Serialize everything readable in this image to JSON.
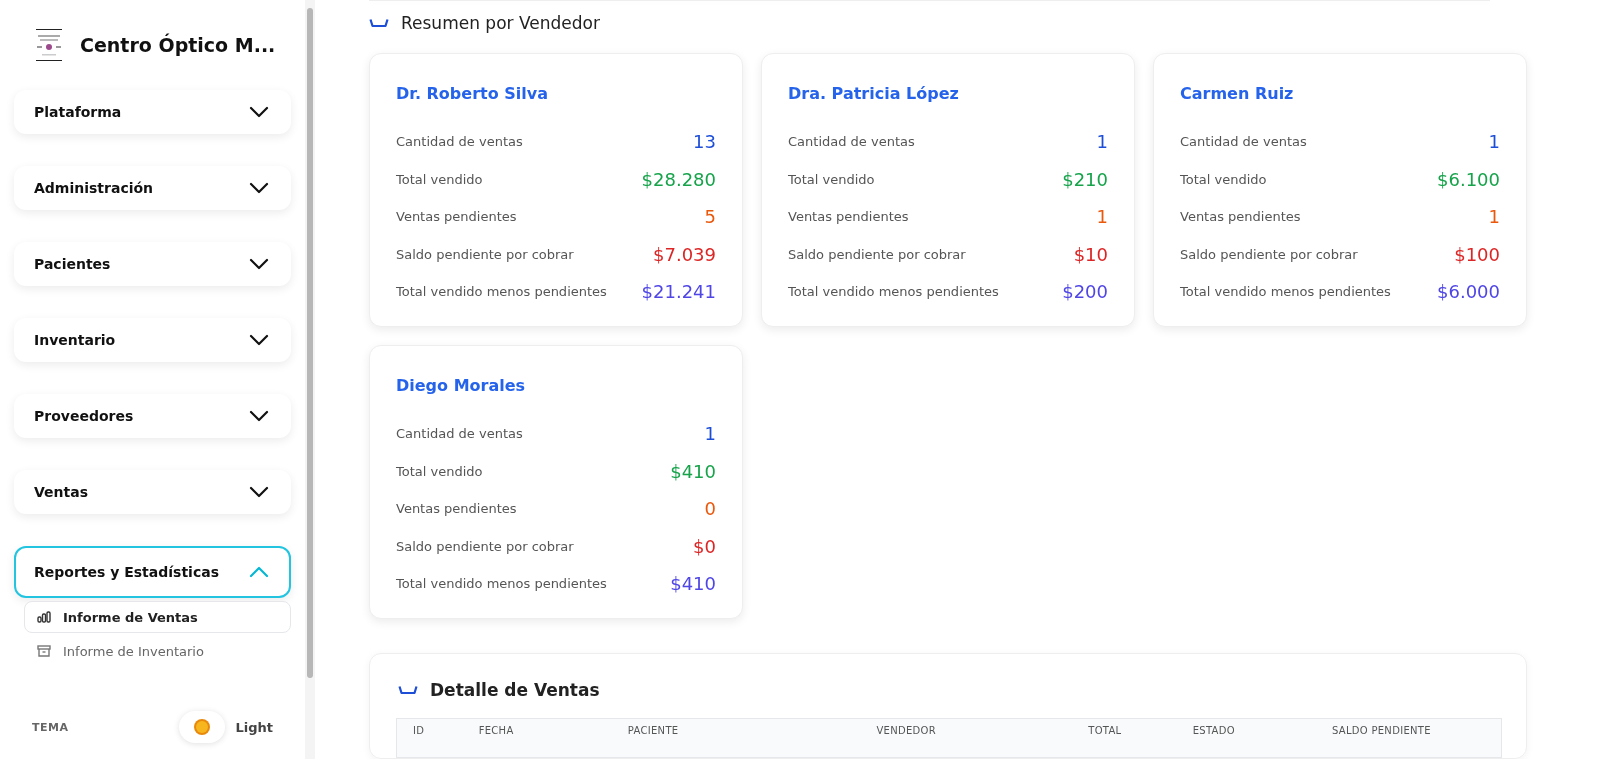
{
  "brand": {
    "name": "Centro Óptico M..."
  },
  "nav": [
    {
      "label": "Plataforma",
      "expanded": false
    },
    {
      "label": "Administración",
      "expanded": false
    },
    {
      "label": "Pacientes",
      "expanded": false
    },
    {
      "label": "Inventario",
      "expanded": false
    },
    {
      "label": "Proveedores",
      "expanded": false
    },
    {
      "label": "Ventas",
      "expanded": false
    },
    {
      "label": "Reportes y Estadísticas",
      "expanded": true,
      "children": [
        {
          "label": "Informe de Ventas",
          "kind": "chart",
          "selected": true
        },
        {
          "label": "Informe de Inventario",
          "kind": "archive",
          "selected": false
        }
      ]
    }
  ],
  "theme": {
    "label": "TEMA",
    "mode": "Light"
  },
  "summary": {
    "title": "Resumen por Vendedor",
    "sellers": [
      {
        "name": "Dr. Roberto Silva",
        "metrics": [
          {
            "label": "Cantidad de ventas",
            "value": "13",
            "kind": "count"
          },
          {
            "label": "Total vendido",
            "value": "$28.280",
            "kind": "total"
          },
          {
            "label": "Ventas pendientes",
            "value": "5",
            "kind": "pending"
          },
          {
            "label": "Saldo pendiente por cobrar",
            "value": "$7.039",
            "kind": "balance"
          },
          {
            "label": "Total vendido menos pendientes",
            "value": "$21.241",
            "kind": "net"
          }
        ]
      },
      {
        "name": "Dra. Patricia López",
        "metrics": [
          {
            "label": "Cantidad de ventas",
            "value": "1",
            "kind": "count"
          },
          {
            "label": "Total vendido",
            "value": "$210",
            "kind": "total"
          },
          {
            "label": "Ventas pendientes",
            "value": "1",
            "kind": "pending"
          },
          {
            "label": "Saldo pendiente por cobrar",
            "value": "$10",
            "kind": "balance"
          },
          {
            "label": "Total vendido menos pendientes",
            "value": "$200",
            "kind": "net"
          }
        ]
      },
      {
        "name": "Carmen Ruiz",
        "metrics": [
          {
            "label": "Cantidad de ventas",
            "value": "1",
            "kind": "count"
          },
          {
            "label": "Total vendido",
            "value": "$6.100",
            "kind": "total"
          },
          {
            "label": "Ventas pendientes",
            "value": "1",
            "kind": "pending"
          },
          {
            "label": "Saldo pendiente por cobrar",
            "value": "$100",
            "kind": "balance"
          },
          {
            "label": "Total vendido menos pendientes",
            "value": "$6.000",
            "kind": "net"
          }
        ]
      },
      {
        "name": "Diego Morales",
        "metrics": [
          {
            "label": "Cantidad de ventas",
            "value": "1",
            "kind": "count"
          },
          {
            "label": "Total vendido",
            "value": "$410",
            "kind": "total"
          },
          {
            "label": "Ventas pendientes",
            "value": "0",
            "kind": "pending"
          },
          {
            "label": "Saldo pendiente por cobrar",
            "value": "$0",
            "kind": "balance"
          },
          {
            "label": "Total vendido menos pendientes",
            "value": "$410",
            "kind": "net"
          }
        ]
      }
    ]
  },
  "detail": {
    "title": "Detalle de Ventas",
    "table": {
      "columns": [
        "ID",
        "FECHA",
        "PACIENTE",
        "VENDEDOR",
        "TOTAL",
        "ESTADO",
        "SALDO PENDIENTE"
      ]
    }
  }
}
